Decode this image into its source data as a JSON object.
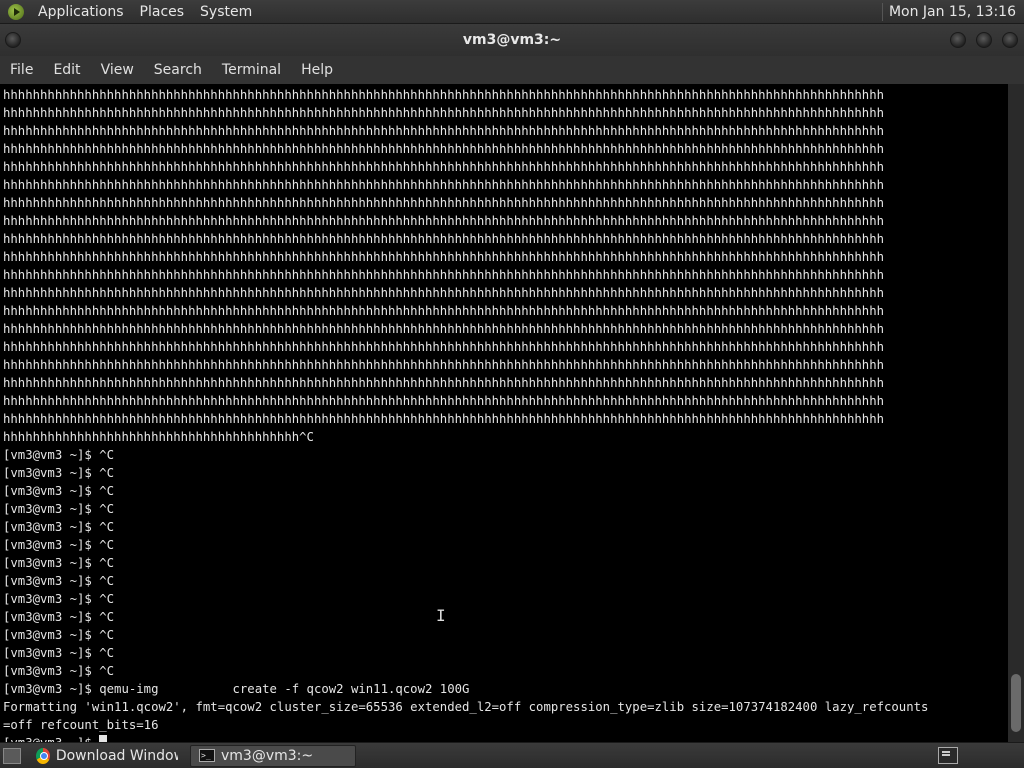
{
  "top_panel": {
    "menus": [
      "Applications",
      "Places",
      "System"
    ],
    "clock": "Mon Jan 15, 13:16"
  },
  "window": {
    "title": "vm3@vm3:~"
  },
  "menubar": {
    "items": [
      "File",
      "Edit",
      "View",
      "Search",
      "Terminal",
      "Help"
    ]
  },
  "terminal": {
    "lines": [
      "hhhhhhhhhhhhhhhhhhhhhhhhhhhhhhhhhhhhhhhhhhhhhhhhhhhhhhhhhhhhhhhhhhhhhhhhhhhhhhhhhhhhhhhhhhhhhhhhhhhhhhhhhhhhhhhhhhhhhhh",
      "hhhhhhhhhhhhhhhhhhhhhhhhhhhhhhhhhhhhhhhhhhhhhhhhhhhhhhhhhhhhhhhhhhhhhhhhhhhhhhhhhhhhhhhhhhhhhhhhhhhhhhhhhhhhhhhhhhhhhhh",
      "hhhhhhhhhhhhhhhhhhhhhhhhhhhhhhhhhhhhhhhhhhhhhhhhhhhhhhhhhhhhhhhhhhhhhhhhhhhhhhhhhhhhhhhhhhhhhhhhhhhhhhhhhhhhhhhhhhhhhhh",
      "hhhhhhhhhhhhhhhhhhhhhhhhhhhhhhhhhhhhhhhhhhhhhhhhhhhhhhhhhhhhhhhhhhhhhhhhhhhhhhhhhhhhhhhhhhhhhhhhhhhhhhhhhhhhhhhhhhhhhhh",
      "hhhhhhhhhhhhhhhhhhhhhhhhhhhhhhhhhhhhhhhhhhhhhhhhhhhhhhhhhhhhhhhhhhhhhhhhhhhhhhhhhhhhhhhhhhhhhhhhhhhhhhhhhhhhhhhhhhhhhhh",
      "hhhhhhhhhhhhhhhhhhhhhhhhhhhhhhhhhhhhhhhhhhhhhhhhhhhhhhhhhhhhhhhhhhhhhhhhhhhhhhhhhhhhhhhhhhhhhhhhhhhhhhhhhhhhhhhhhhhhhhh",
      "hhhhhhhhhhhhhhhhhhhhhhhhhhhhhhhhhhhhhhhhhhhhhhhhhhhhhhhhhhhhhhhhhhhhhhhhhhhhhhhhhhhhhhhhhhhhhhhhhhhhhhhhhhhhhhhhhhhhhhh",
      "hhhhhhhhhhhhhhhhhhhhhhhhhhhhhhhhhhhhhhhhhhhhhhhhhhhhhhhhhhhhhhhhhhhhhhhhhhhhhhhhhhhhhhhhhhhhhhhhhhhhhhhhhhhhhhhhhhhhhhh",
      "hhhhhhhhhhhhhhhhhhhhhhhhhhhhhhhhhhhhhhhhhhhhhhhhhhhhhhhhhhhhhhhhhhhhhhhhhhhhhhhhhhhhhhhhhhhhhhhhhhhhhhhhhhhhhhhhhhhhhhh",
      "hhhhhhhhhhhhhhhhhhhhhhhhhhhhhhhhhhhhhhhhhhhhhhhhhhhhhhhhhhhhhhhhhhhhhhhhhhhhhhhhhhhhhhhhhhhhhhhhhhhhhhhhhhhhhhhhhhhhhhh",
      "hhhhhhhhhhhhhhhhhhhhhhhhhhhhhhhhhhhhhhhhhhhhhhhhhhhhhhhhhhhhhhhhhhhhhhhhhhhhhhhhhhhhhhhhhhhhhhhhhhhhhhhhhhhhhhhhhhhhhhh",
      "hhhhhhhhhhhhhhhhhhhhhhhhhhhhhhhhhhhhhhhhhhhhhhhhhhhhhhhhhhhhhhhhhhhhhhhhhhhhhhhhhhhhhhhhhhhhhhhhhhhhhhhhhhhhhhhhhhhhhhh",
      "hhhhhhhhhhhhhhhhhhhhhhhhhhhhhhhhhhhhhhhhhhhhhhhhhhhhhhhhhhhhhhhhhhhhhhhhhhhhhhhhhhhhhhhhhhhhhhhhhhhhhhhhhhhhhhhhhhhhhhh",
      "hhhhhhhhhhhhhhhhhhhhhhhhhhhhhhhhhhhhhhhhhhhhhhhhhhhhhhhhhhhhhhhhhhhhhhhhhhhhhhhhhhhhhhhhhhhhhhhhhhhhhhhhhhhhhhhhhhhhhhh",
      "hhhhhhhhhhhhhhhhhhhhhhhhhhhhhhhhhhhhhhhhhhhhhhhhhhhhhhhhhhhhhhhhhhhhhhhhhhhhhhhhhhhhhhhhhhhhhhhhhhhhhhhhhhhhhhhhhhhhhhh",
      "hhhhhhhhhhhhhhhhhhhhhhhhhhhhhhhhhhhhhhhhhhhhhhhhhhhhhhhhhhhhhhhhhhhhhhhhhhhhhhhhhhhhhhhhhhhhhhhhhhhhhhhhhhhhhhhhhhhhhhh",
      "hhhhhhhhhhhhhhhhhhhhhhhhhhhhhhhhhhhhhhhhhhhhhhhhhhhhhhhhhhhhhhhhhhhhhhhhhhhhhhhhhhhhhhhhhhhhhhhhhhhhhhhhhhhhhhhhhhhhhhh",
      "hhhhhhhhhhhhhhhhhhhhhhhhhhhhhhhhhhhhhhhhhhhhhhhhhhhhhhhhhhhhhhhhhhhhhhhhhhhhhhhhhhhhhhhhhhhhhhhhhhhhhhhhhhhhhhhhhhhhhhh",
      "hhhhhhhhhhhhhhhhhhhhhhhhhhhhhhhhhhhhhhhhhhhhhhhhhhhhhhhhhhhhhhhhhhhhhhhhhhhhhhhhhhhhhhhhhhhhhhhhhhhhhhhhhhhhhhhhhhhhhhh",
      "hhhhhhhhhhhhhhhhhhhhhhhhhhhhhhhhhhhhhhhh^C",
      "[vm3@vm3 ~]$ ^C",
      "[vm3@vm3 ~]$ ^C",
      "[vm3@vm3 ~]$ ^C",
      "[vm3@vm3 ~]$ ^C",
      "[vm3@vm3 ~]$ ^C",
      "[vm3@vm3 ~]$ ^C",
      "[vm3@vm3 ~]$ ^C",
      "[vm3@vm3 ~]$ ^C",
      "[vm3@vm3 ~]$ ^C",
      "[vm3@vm3 ~]$ ^C",
      "[vm3@vm3 ~]$ ^C",
      "[vm3@vm3 ~]$ ^C",
      "[vm3@vm3 ~]$ ^C",
      "[vm3@vm3 ~]$ qemu-img          create -f qcow2 win11.qcow2 100G",
      "Formatting 'win11.qcow2', fmt=qcow2 cluster_size=65536 extended_l2=off compression_type=zlib size=107374182400 lazy_refcounts",
      "=off refcount_bits=16"
    ],
    "prompt": "[vm3@vm3 ~]$ "
  },
  "taskbar": {
    "tasks": [
      {
        "label": "Download Window...",
        "icon": "chrome-icon",
        "active": false
      },
      {
        "label": "vm3@vm3:~",
        "icon": "terminal-icon",
        "active": true
      }
    ]
  }
}
